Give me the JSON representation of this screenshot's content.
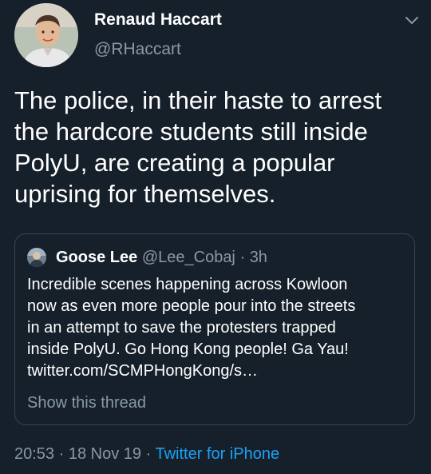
{
  "author": {
    "name": "Renaud Haccart",
    "handle": "@RHaccart",
    "avatar_icon": "profile-photo"
  },
  "tweet": {
    "lines": [
      "The police, in their haste to arrest",
      "the hardcore students still inside",
      "PolyU, are creating a popular",
      "uprising for themselves."
    ]
  },
  "quoted": {
    "name": "Goose Lee",
    "handle": "@Lee_Cobaj",
    "separator": "·",
    "time": "3h",
    "lines": [
      "Incredible scenes happening across Kowloon",
      "now as even more people pour into the streets",
      "in an attempt to save the protesters trapped",
      "inside PolyU. Go Hong Kong people! Ga Yau!",
      "twitter.com/SCMPHongKong/s…"
    ],
    "show_thread": "Show this thread"
  },
  "footer": {
    "time": "20:53",
    "sep1": "·",
    "date": "18 Nov 19",
    "sep2": "·",
    "source": "Twitter for iPhone"
  },
  "colors": {
    "background": "#15202b",
    "secondary_text": "#8899a6",
    "link": "#1da1f2",
    "border": "#38444d"
  }
}
